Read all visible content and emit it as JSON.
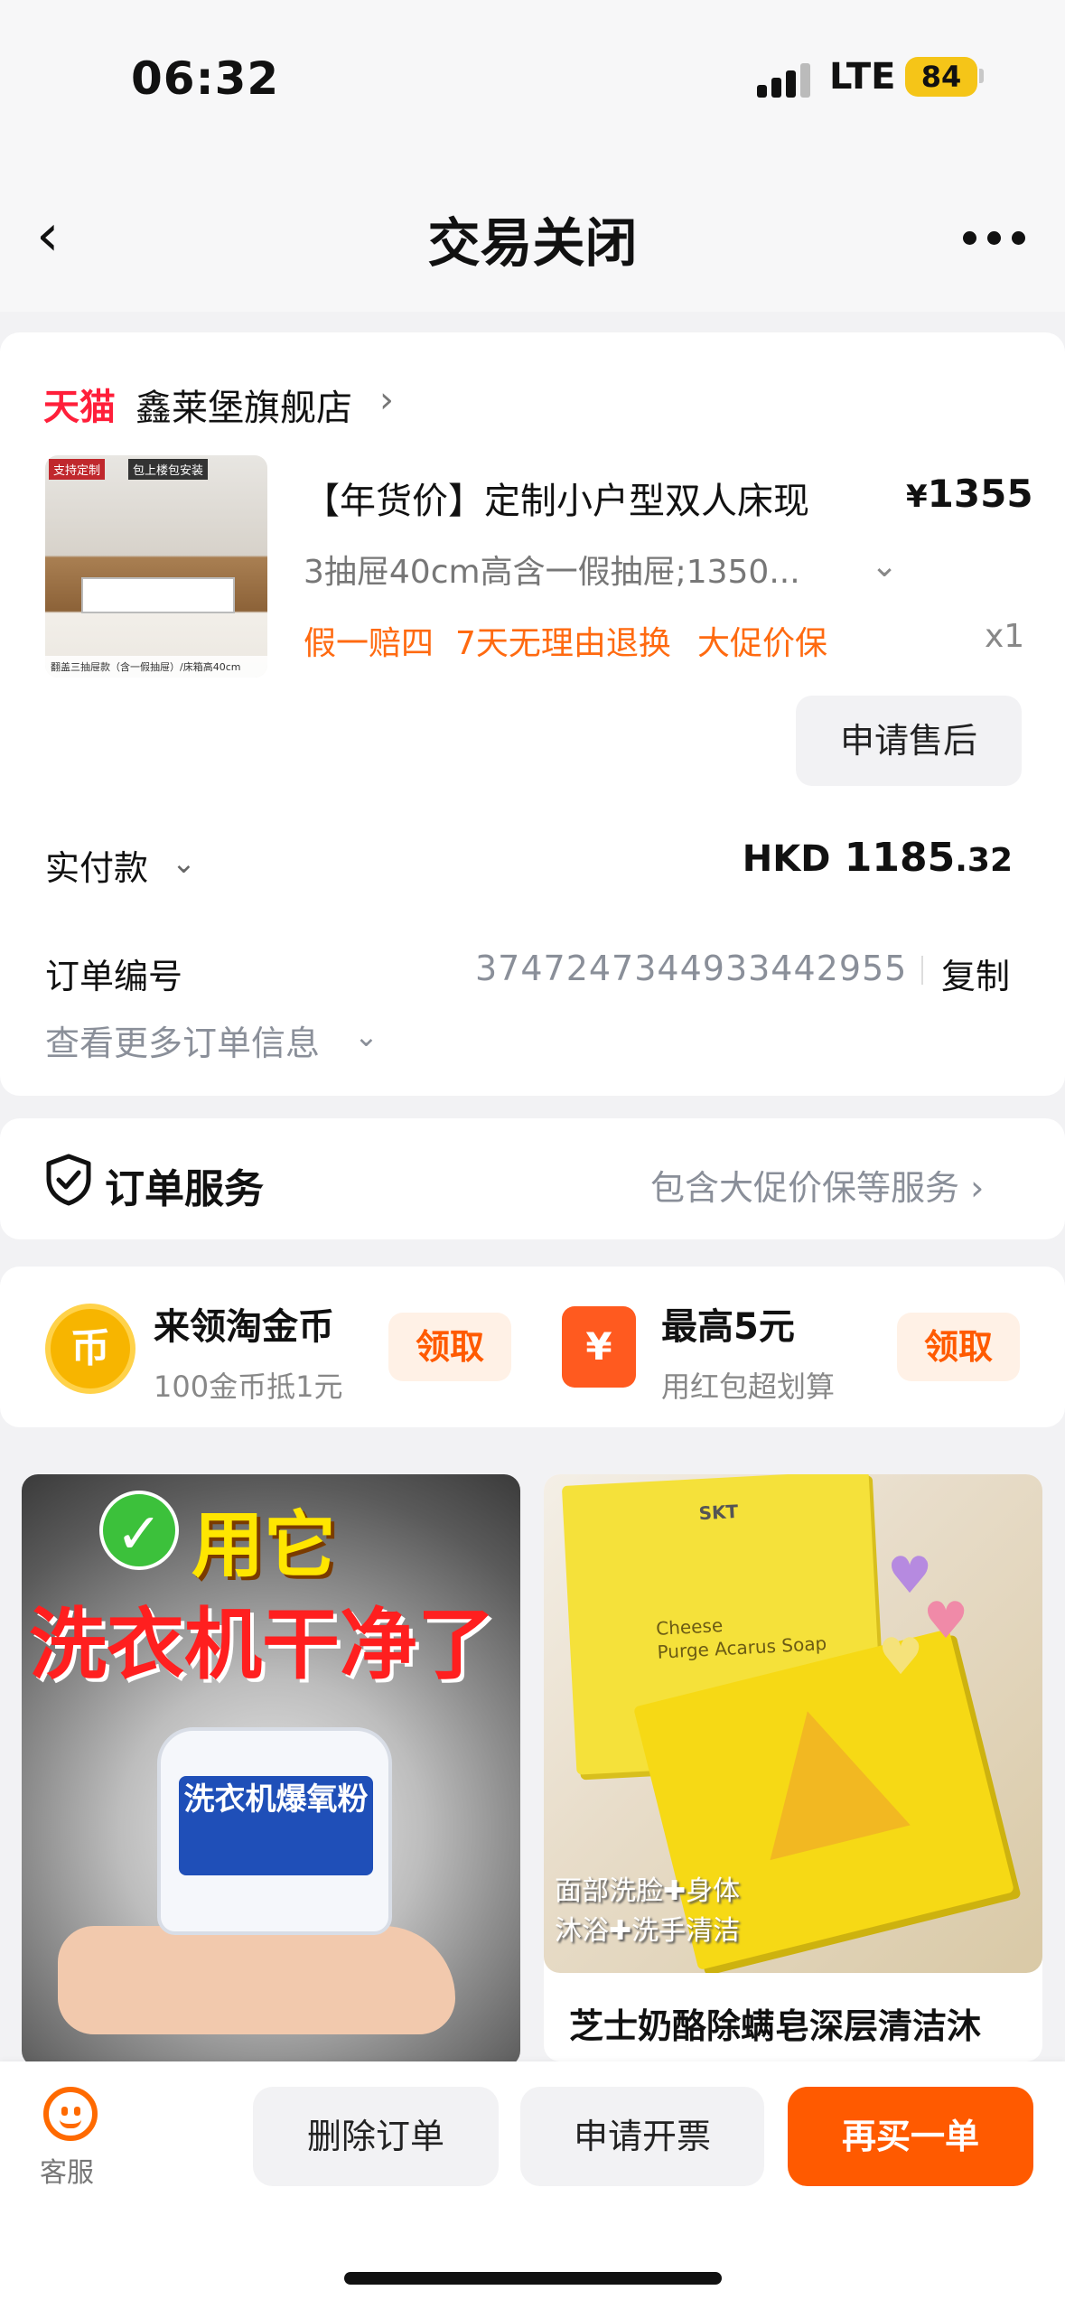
{
  "status_bar": {
    "time": "06:32",
    "network": "LTE",
    "battery": "84"
  },
  "nav": {
    "title": "交易关闭"
  },
  "shop": {
    "platform": "天猫",
    "name": "鑫莱堡旗舰店"
  },
  "product": {
    "thumb_tag1": "支持定制",
    "thumb_tag2": "包上楼包安装",
    "thumb_caption": "翻盖三抽屉款（含一假抽屉）/床箱高40cm",
    "title": "【年货价】定制小户型双人床现",
    "price_symbol": "¥",
    "price": "1355",
    "sku": "3抽屉40cm高含一假抽屉;1350...",
    "services": [
      "假一赔四",
      "7天无理由退换",
      "大促价保"
    ],
    "quantity": "x1",
    "after_sale_button": "申请售后"
  },
  "payment": {
    "label": "实付款",
    "currency": "HKD",
    "amount_int": "1185",
    "amount_dec": ".32"
  },
  "order": {
    "number_label": "订单编号",
    "number": "3747247344933442955",
    "copy_label": "复制",
    "more_info": "查看更多订单信息"
  },
  "service_section": {
    "title": "订单服务",
    "desc": "包含大促价保等服务"
  },
  "promos": [
    {
      "icon": "币",
      "title": "来领淘金币",
      "sub": "100金币抵1元",
      "button": "领取"
    },
    {
      "icon": "¥",
      "title": "最高5元",
      "sub": "用红包超划算",
      "button": "领取"
    }
  ],
  "recommend": [
    {
      "img_headline1": "用它",
      "img_headline2": "洗衣机干净了",
      "img_label": "洗衣机爆氧粉"
    },
    {
      "img_brand": "SKT",
      "img_name_line1": "Cheese",
      "img_name_line2": "Purge Acarus Soap",
      "img_overlay_line1": "面部洗脸✚身体",
      "img_overlay_line2": "沐浴✚洗手清洁",
      "title": "芝士奶酪除螨皂深层清洁沐"
    }
  ],
  "bottom_bar": {
    "service_label": "客服",
    "delete_button": "删除订单",
    "invoice_button": "申请开票",
    "rebuy_button": "再买一单"
  },
  "colors": {
    "accent": "#ff5a00",
    "tmall_red": "#ff1f3a",
    "service_orange": "#ff6a10"
  }
}
